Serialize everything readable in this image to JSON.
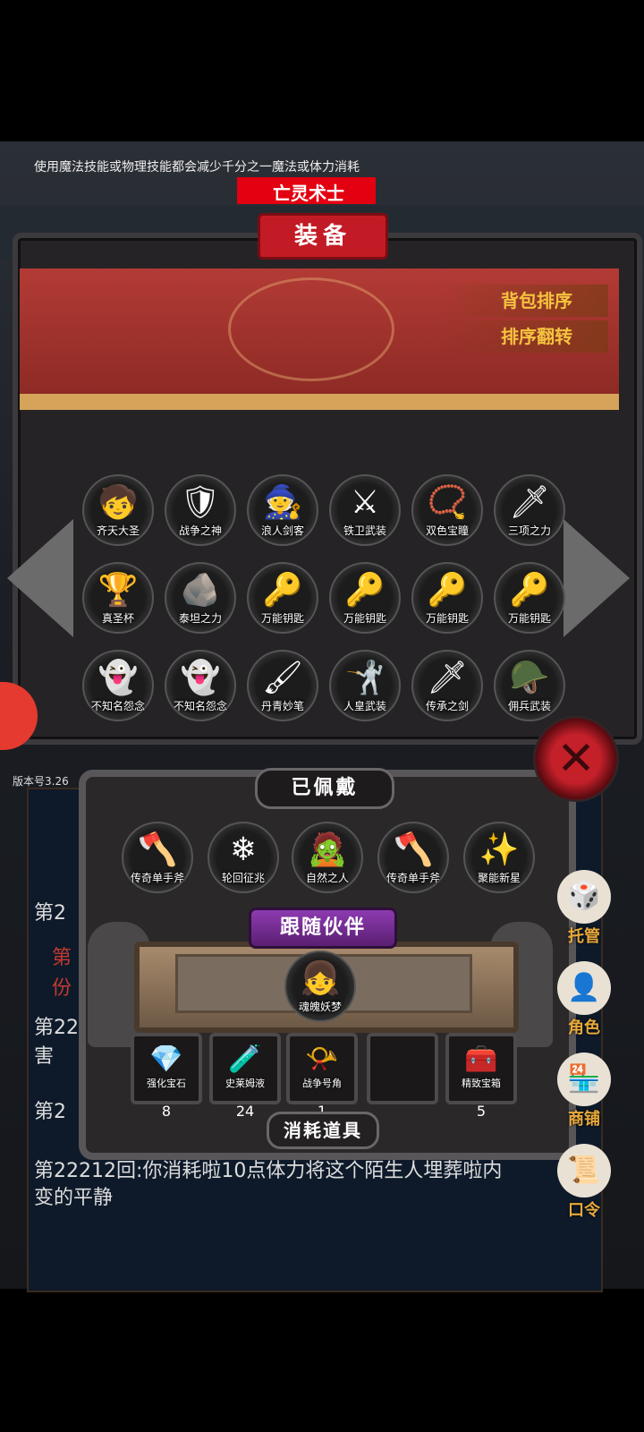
{
  "hint": "使用魔法技能或物理技能都会减少千分之一魔法或体力消耗",
  "class_name": "亡灵术士",
  "panel_title": "装备",
  "sort_buttons": [
    "背包排序",
    "排序翻转"
  ],
  "inventory": [
    {
      "label": "齐天大圣",
      "icon": "monkey-king-icon",
      "glyph": "🧒"
    },
    {
      "label": "战争之神",
      "icon": "war-god-icon",
      "glyph": "🛡"
    },
    {
      "label": "浪人剑客",
      "icon": "ronin-icon",
      "glyph": "🧙"
    },
    {
      "label": "铁卫武装",
      "icon": "iron-guard-icon",
      "glyph": "⚔"
    },
    {
      "label": "双色宝瞳",
      "icon": "twin-gem-icon",
      "glyph": "📿"
    },
    {
      "label": "三项之力",
      "icon": "triple-power-icon",
      "glyph": "🗡"
    },
    {
      "label": "真圣杯",
      "icon": "grail-icon",
      "glyph": "🏆"
    },
    {
      "label": "泰坦之力",
      "icon": "titan-icon",
      "glyph": "🪨"
    },
    {
      "label": "万能钥匙",
      "icon": "key-icon",
      "glyph": "🔑"
    },
    {
      "label": "万能钥匙",
      "icon": "key-icon",
      "glyph": "🔑"
    },
    {
      "label": "万能钥匙",
      "icon": "key-icon",
      "glyph": "🔑"
    },
    {
      "label": "万能钥匙",
      "icon": "key-icon",
      "glyph": "🔑"
    },
    {
      "label": "不知名怨念",
      "icon": "ghost-icon",
      "glyph": "👻"
    },
    {
      "label": "不知名怨念",
      "icon": "ghost-icon",
      "glyph": "👻"
    },
    {
      "label": "丹青妙笔",
      "icon": "brush-icon",
      "glyph": "🖌"
    },
    {
      "label": "人皇武装",
      "icon": "emperor-armor-icon",
      "glyph": "🤺"
    },
    {
      "label": "传承之剑",
      "icon": "sword-icon",
      "glyph": "🗡"
    },
    {
      "label": "佣兵武装",
      "icon": "mercenary-icon",
      "glyph": "🪖"
    }
  ],
  "version": "版本号3.26",
  "equipped_title": "已佩戴",
  "equipped": [
    {
      "label": "传奇单手斧",
      "icon": "axe-icon",
      "glyph": "🪓"
    },
    {
      "label": "轮回征兆",
      "icon": "ice-crystal-icon",
      "glyph": "❄"
    },
    {
      "label": "自然之人",
      "icon": "nature-figure-icon",
      "glyph": "🧟"
    },
    {
      "label": "传奇单手斧",
      "icon": "axe-icon",
      "glyph": "🪓"
    },
    {
      "label": "聚能新星",
      "icon": "nova-icon",
      "glyph": "✨"
    }
  ],
  "companion_title": "跟随伙伴",
  "companion": {
    "label": "魂魄妖梦",
    "icon": "ghost-girl-icon",
    "glyph": "👧"
  },
  "consumables_title": "消耗道具",
  "consumables": [
    {
      "label": "强化宝石",
      "count": "8",
      "icon": "gem-icon",
      "glyph": "💎"
    },
    {
      "label": "史莱姆液",
      "count": "24",
      "icon": "potion-icon",
      "glyph": "🧪"
    },
    {
      "label": "战争号角",
      "count": "1",
      "icon": "horn-icon",
      "glyph": "📯"
    },
    {
      "label": "",
      "count": "",
      "icon": "",
      "glyph": ""
    },
    {
      "label": "精致宝箱",
      "count": "5",
      "icon": "chest-icon",
      "glyph": "🧰"
    }
  ],
  "right_menu": [
    {
      "label": "托管",
      "icon": "dice-icon",
      "glyph": "🎲"
    },
    {
      "label": "角色",
      "icon": "hooded-figure-icon",
      "glyph": "👤"
    },
    {
      "label": "商铺",
      "icon": "shop-icon",
      "glyph": "🏪"
    },
    {
      "label": "口令",
      "icon": "scroll-icon",
      "glyph": "📜"
    }
  ],
  "log_lines": [
    "第2",
    "第",
    "份",
    "第22",
    "害",
    "第2",
    "第22212回:你消耗啦10点体力将这个陌生人埋葬啦内",
    "变的平静"
  ]
}
